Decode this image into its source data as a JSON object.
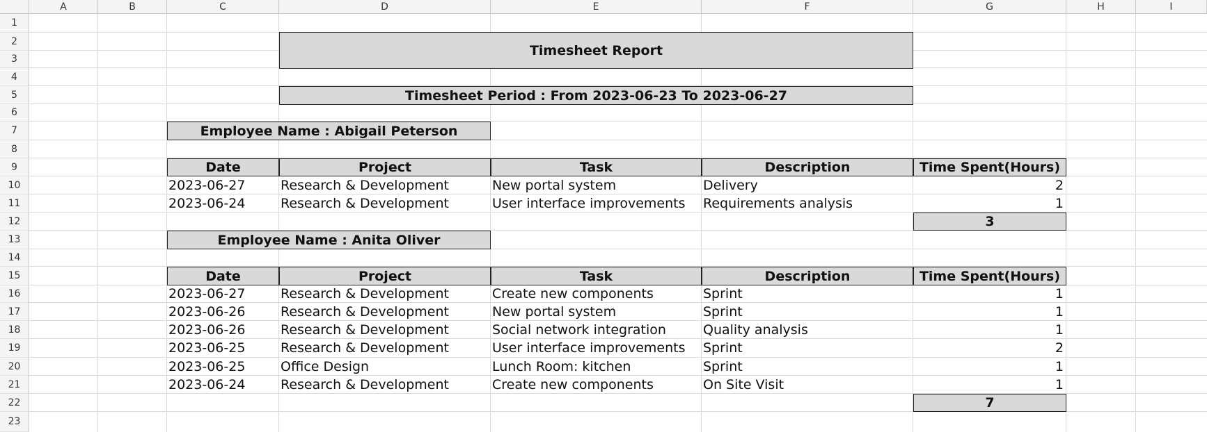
{
  "columns": [
    "A",
    "B",
    "C",
    "D",
    "E",
    "F",
    "G",
    "H",
    "I"
  ],
  "rows": [
    "1",
    "2",
    "3",
    "4",
    "5",
    "6",
    "7",
    "8",
    "9",
    "10",
    "11",
    "12",
    "13",
    "14",
    "15",
    "16",
    "17",
    "18",
    "19",
    "20",
    "21",
    "22",
    "23"
  ],
  "report": {
    "title": "Timesheet Report",
    "period": "Timesheet Period : From 2023-06-23 To 2023-06-27",
    "headers": [
      "Date",
      "Project",
      "Task",
      "Description",
      "Time Spent(Hours)"
    ]
  },
  "employees": [
    {
      "name": "Employee Name : Abigail Peterson",
      "entries": [
        {
          "date": "2023-06-27",
          "project": "Research & Development",
          "task": "New portal system",
          "description": "Delivery",
          "hours": "2"
        },
        {
          "date": "2023-06-24",
          "project": "Research & Development",
          "task": "User interface improvements",
          "description": "Requirements analysis",
          "hours": "1"
        }
      ],
      "total": "3"
    },
    {
      "name": "Employee Name : Anita Oliver",
      "entries": [
        {
          "date": "2023-06-27",
          "project": "Research & Development",
          "task": "Create new components",
          "description": "Sprint",
          "hours": "1"
        },
        {
          "date": "2023-06-26",
          "project": "Research & Development",
          "task": "New portal system",
          "description": "Sprint",
          "hours": "1"
        },
        {
          "date": "2023-06-26",
          "project": "Research & Development",
          "task": "Social network integration",
          "description": "Quality analysis",
          "hours": "1"
        },
        {
          "date": "2023-06-25",
          "project": "Research & Development",
          "task": "User interface improvements",
          "description": "Sprint",
          "hours": "2"
        },
        {
          "date": "2023-06-25",
          "project": "Office Design",
          "task": "Lunch Room: kitchen",
          "description": "Sprint",
          "hours": "1"
        },
        {
          "date": "2023-06-24",
          "project": "Research & Development",
          "task": "Create new components",
          "description": "On Site Visit",
          "hours": "1"
        }
      ],
      "total": "7"
    }
  ]
}
